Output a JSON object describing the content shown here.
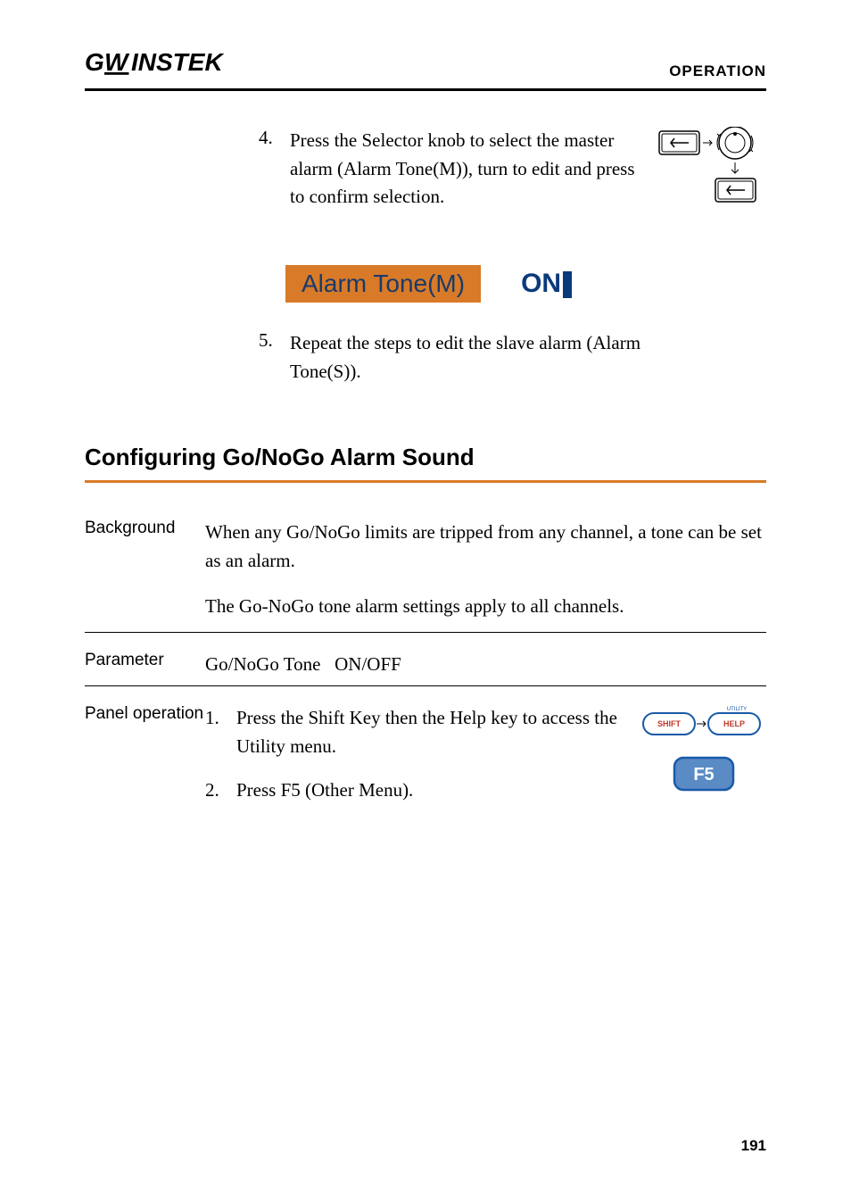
{
  "header": {
    "logo": "GWINSTEK",
    "section": "OPERATION"
  },
  "top_steps": [
    {
      "num": "4.",
      "text": "Press the Selector knob to select the master alarm (Alarm Tone(M)), turn to edit and press to confirm selection."
    },
    {
      "num": "5.",
      "text": "Repeat the steps to edit the slave alarm (Alarm Tone(S))."
    }
  ],
  "alarm_display": {
    "label": "Alarm Tone(M)",
    "state": "ON"
  },
  "section_title": "Configuring Go/NoGo Alarm Sound",
  "background": {
    "label": "Background",
    "p1": "When any Go/NoGo limits are tripped from any channel, a tone can be set as an alarm.",
    "p2": "The Go-NoGo tone alarm settings apply to all channels."
  },
  "parameter": {
    "label": "Parameter",
    "value": "Go/NoGo Tone   ON/OFF"
  },
  "panel_op": {
    "label": "Panel operation",
    "steps": [
      {
        "num": "1.",
        "text": "Press the Shift Key then the Help key to access the Utility menu."
      },
      {
        "num": "2.",
        "text": "Press F5 (Other Menu)."
      }
    ],
    "shift_label": "SHIFT",
    "help_label": "HELP",
    "utility_label": "UTILITY",
    "f5_label": "F5"
  },
  "page_number": "191"
}
